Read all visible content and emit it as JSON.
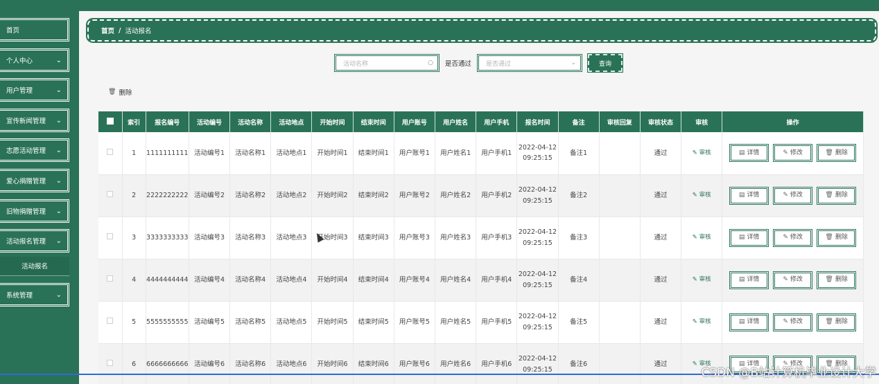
{
  "sidebar": {
    "items": [
      {
        "label": "首页",
        "has_chevron": false
      },
      {
        "label": "个人中心",
        "has_chevron": true
      },
      {
        "label": "用户管理",
        "has_chevron": true
      },
      {
        "label": "宣传新闻管理",
        "has_chevron": true
      },
      {
        "label": "志愿活动管理",
        "has_chevron": true
      },
      {
        "label": "爱心捐赠管理",
        "has_chevron": true
      },
      {
        "label": "旧物捐赠管理",
        "has_chevron": true
      },
      {
        "label": "活动报名管理",
        "has_chevron": true
      }
    ],
    "sub_item": "活动报名",
    "last_item": {
      "label": "系统管理",
      "has_chevron": true
    }
  },
  "breadcrumb": {
    "home": "首页",
    "separator": "/",
    "current": "活动报名"
  },
  "search": {
    "name_placeholder": "活动名称",
    "pass_label": "是否通过",
    "pass_placeholder": "是否通过",
    "query_label": "查询"
  },
  "toolbar": {
    "delete_label": "删除"
  },
  "table": {
    "headers": [
      "索引",
      "报名编号",
      "活动编号",
      "活动名称",
      "活动地点",
      "开始时间",
      "结束时间",
      "用户账号",
      "用户姓名",
      "用户手机",
      "报名时间",
      "备注",
      "审核回复",
      "审核状态",
      "审核",
      "操作"
    ],
    "rows": [
      {
        "index": "1",
        "reg_no": "1111111111",
        "act_no": "活动编号1",
        "act_name": "活动名称1",
        "place": "活动地点1",
        "start": "开始时间1",
        "end": "结束时间1",
        "account": "用户账号1",
        "name": "用户姓名1",
        "phone": "用户手机1",
        "reg_time": "2022-04-12 09:25:15",
        "remark": "备注1",
        "reply": "",
        "status": "通过"
      },
      {
        "index": "2",
        "reg_no": "2222222222",
        "act_no": "活动编号2",
        "act_name": "活动名称2",
        "place": "活动地点2",
        "start": "开始时间2",
        "end": "结束时间2",
        "account": "用户账号2",
        "name": "用户姓名2",
        "phone": "用户手机2",
        "reg_time": "2022-04-12 09:25:15",
        "remark": "备注2",
        "reply": "",
        "status": "通过"
      },
      {
        "index": "3",
        "reg_no": "3333333333",
        "act_no": "活动编号3",
        "act_name": "活动名称3",
        "place": "活动地点3",
        "start": "开始时间3",
        "end": "结束时间3",
        "account": "用户账号3",
        "name": "用户姓名3",
        "phone": "用户手机3",
        "reg_time": "2022-04-12 09:25:15",
        "remark": "备注3",
        "reply": "",
        "status": "通过"
      },
      {
        "index": "4",
        "reg_no": "4444444444",
        "act_no": "活动编号4",
        "act_name": "活动名称4",
        "place": "活动地点4",
        "start": "开始时间4",
        "end": "结束时间4",
        "account": "用户账号4",
        "name": "用户姓名4",
        "phone": "用户手机4",
        "reg_time": "2022-04-12 09:25:15",
        "remark": "备注4",
        "reply": "",
        "status": "通过"
      },
      {
        "index": "5",
        "reg_no": "5555555555",
        "act_no": "活动编号5",
        "act_name": "活动名称5",
        "place": "活动地点5",
        "start": "开始时间5",
        "end": "结束时间5",
        "account": "用户账号5",
        "name": "用户姓名5",
        "phone": "用户手机5",
        "reg_time": "2022-04-12 09:25:15",
        "remark": "备注5",
        "reply": "",
        "status": "通过"
      },
      {
        "index": "6",
        "reg_no": "6666666666",
        "act_no": "活动编号6",
        "act_name": "活动名称6",
        "place": "活动地点6",
        "start": "开始时间6",
        "end": "结束时间6",
        "account": "用户账号6",
        "name": "用户姓名6",
        "phone": "用户手机6",
        "reg_time": "2022-04-12 09:25:15",
        "remark": "备注6",
        "reply": "",
        "status": "通过"
      }
    ],
    "audit_label": "审核",
    "detail_label": "详情",
    "edit_label": "修改",
    "delete_label": "删除"
  },
  "watermark": "CSDN @B站计算机毕业设计大学",
  "colors": {
    "primary": "#2a7257",
    "bottom_line": "#2c6ad6"
  }
}
